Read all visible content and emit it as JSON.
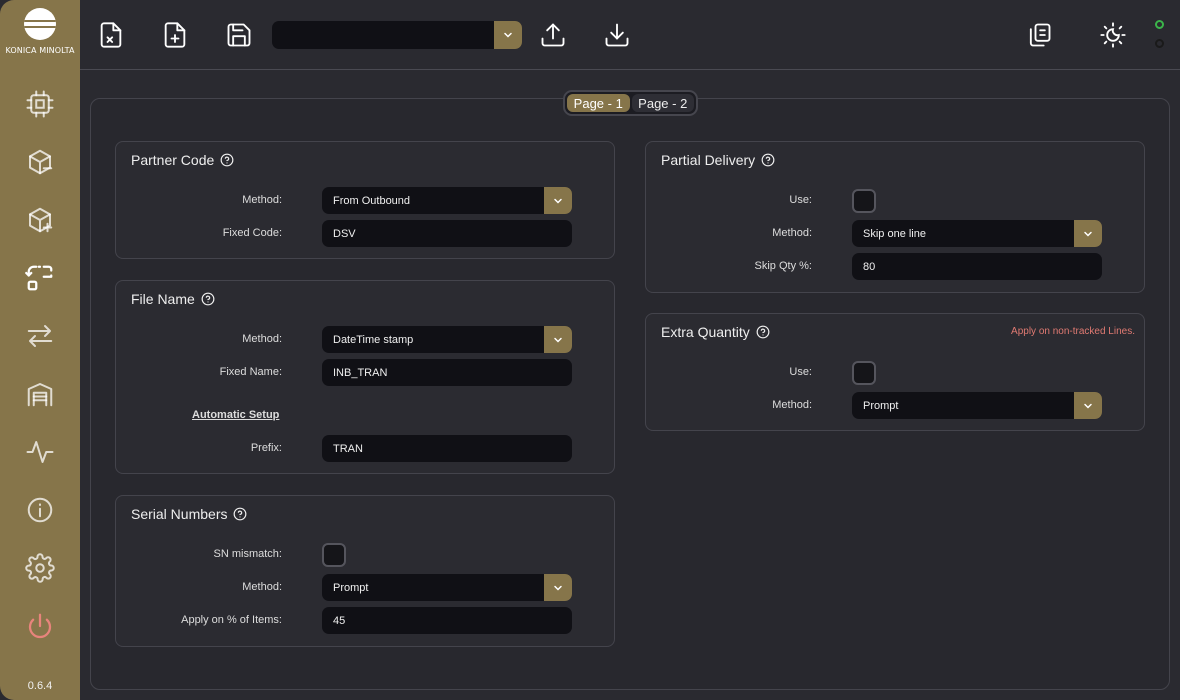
{
  "sidebar": {
    "logo_text": "KONICA MINOLTA",
    "version": "0.6.4",
    "items": [
      {
        "icon": "chip-icon"
      },
      {
        "icon": "package-remove-icon"
      },
      {
        "icon": "package-add-icon"
      },
      {
        "icon": "scan-icon"
      },
      {
        "icon": "transfer-icon"
      },
      {
        "icon": "warehouse-icon"
      },
      {
        "icon": "activity-icon"
      },
      {
        "icon": "info-icon"
      },
      {
        "icon": "settings-icon"
      },
      {
        "icon": "power-icon"
      }
    ]
  },
  "toolbar": {
    "template_select_value": "",
    "icons": [
      "close-file-icon",
      "new-file-icon",
      "save-icon",
      "upload-icon",
      "download-icon",
      "copy-icon",
      "theme-toggle-icon"
    ],
    "status_leds": [
      "#3bb54a",
      "#1a1a1a"
    ]
  },
  "page_tabs": [
    {
      "label": "Page - 1",
      "active": true
    },
    {
      "label": "Page - 2",
      "active": false
    }
  ],
  "partner_code": {
    "title": "Partner Code",
    "method_label": "Method:",
    "method_value": "From Outbound",
    "fixed_code_label": "Fixed Code:",
    "fixed_code_value": "DSV"
  },
  "file_name": {
    "title": "File Name",
    "method_label": "Method:",
    "method_value": "DateTime stamp",
    "fixed_name_label": "Fixed Name:",
    "fixed_name_value": "INB_TRAN",
    "auto_setup_link": "Automatic Setup",
    "prefix_label": "Prefix:",
    "prefix_value": "TRAN"
  },
  "serial_numbers": {
    "title": "Serial Numbers",
    "sn_mismatch_label": "SN mismatch:",
    "sn_mismatch_checked": false,
    "method_label": "Method:",
    "method_value": "Prompt",
    "apply_label": "Apply on % of Items:",
    "apply_value": "45"
  },
  "partial_delivery": {
    "title": "Partial Delivery",
    "use_label": "Use:",
    "use_checked": false,
    "method_label": "Method:",
    "method_value": "Skip one line",
    "skip_qty_label": "Skip Qty %:",
    "skip_qty_value": "80"
  },
  "extra_quantity": {
    "title": "Extra Quantity",
    "note": "Apply on non-tracked Lines.",
    "use_label": "Use:",
    "use_checked": false,
    "method_label": "Method:",
    "method_value": "Prompt"
  },
  "colors": {
    "accent": "#86754a",
    "background": "#2a2a30",
    "field": "#101015",
    "warning_text": "#e07a72",
    "power": "#e8847c"
  }
}
